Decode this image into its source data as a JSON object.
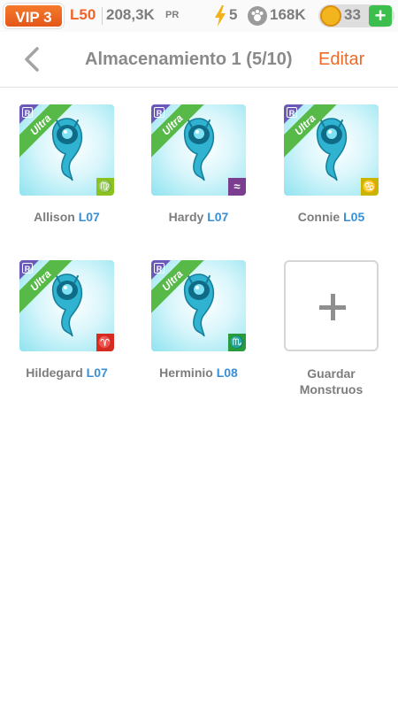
{
  "status": {
    "vip": "VIP 3",
    "level": "L50",
    "power": "208,3K",
    "power_unit": "PR",
    "energy": "5",
    "food": "168K",
    "coins": "33",
    "add": "+"
  },
  "nav": {
    "title": "Almacenamiento 1 (5/10)",
    "edit": "Editar"
  },
  "monsters": [
    {
      "name": "Allison",
      "level": "L07",
      "badge": "Ultra",
      "rarity": "R",
      "zodiac": "♍",
      "zodiac_color": "#8cc21c"
    },
    {
      "name": "Hardy",
      "level": "L07",
      "badge": "Ultra",
      "rarity": "R",
      "zodiac": "≈",
      "zodiac_color": "#7b3e8f"
    },
    {
      "name": "Connie",
      "level": "L05",
      "badge": "Ultra",
      "rarity": "R",
      "zodiac": "♋",
      "zodiac_color": "#c9b400"
    },
    {
      "name": "Hildegard",
      "level": "L07",
      "badge": "Ultra",
      "rarity": "R",
      "zodiac": "♈",
      "zodiac_color": "#d72b1f"
    },
    {
      "name": "Herminio",
      "level": "L08",
      "badge": "Ultra",
      "rarity": "R",
      "zodiac": "♏",
      "zodiac_color": "#2a9b3c"
    }
  ],
  "add_slot": {
    "label_line1": "Guardar",
    "label_line2": "Monstruos"
  },
  "colors": {
    "accent": "#ef6a24",
    "level_blue": "#3a8fd4",
    "ultra_green": "#57b947"
  }
}
